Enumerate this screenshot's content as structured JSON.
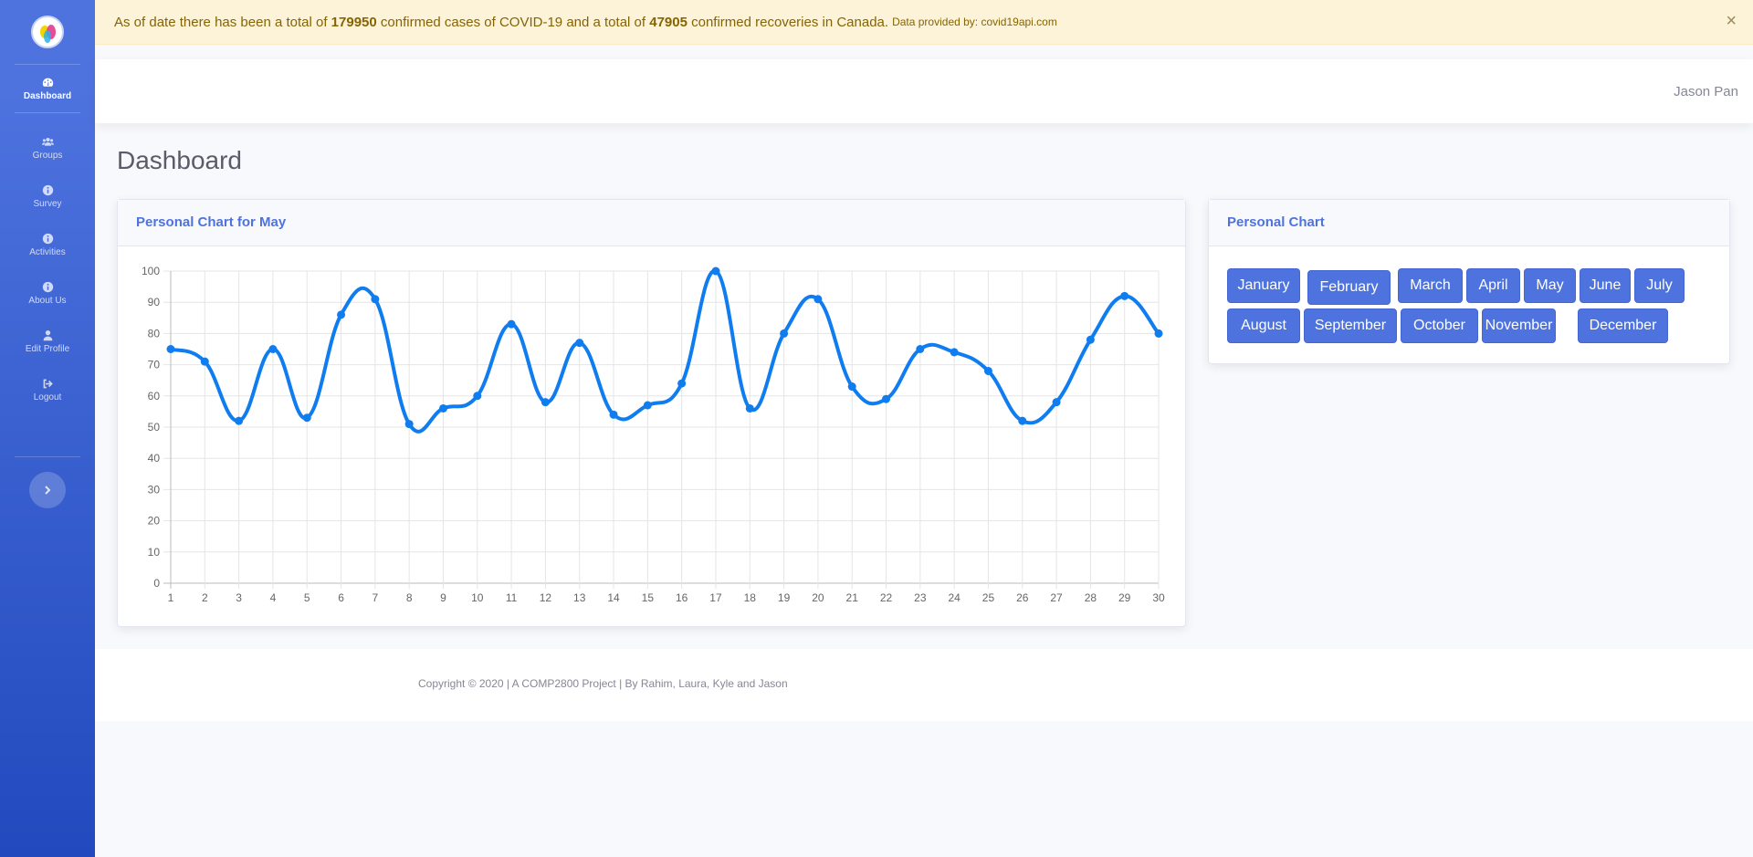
{
  "sidebar": {
    "items": [
      {
        "label": "Dashboard",
        "icon": "tachometer-icon"
      },
      {
        "label": "Groups",
        "icon": "users-icon"
      },
      {
        "label": "Survey",
        "icon": "info-circle-icon"
      },
      {
        "label": "Activities",
        "icon": "info-circle-icon"
      },
      {
        "label": "About Us",
        "icon": "info-circle-icon"
      },
      {
        "label": "Edit Profile",
        "icon": "user-icon"
      },
      {
        "label": "Logout",
        "icon": "sign-out-icon"
      }
    ]
  },
  "alert": {
    "text_1": "As of date there has been a total of",
    "confirmed": "179950",
    "text_2": "confirmed cases of COVID-19 and a total of",
    "recoveries": "47905",
    "text_3": "confirmed recoveries in Canada.",
    "source": "Data provided by: covid19api.com",
    "close": "×"
  },
  "topbar": {
    "user_name": "Jason Pan"
  },
  "page": {
    "title": "Dashboard"
  },
  "main_card": {
    "title": "Personal Chart for May"
  },
  "side_card": {
    "title": "Personal Chart",
    "months": [
      "January",
      "February",
      "March",
      "April",
      "May",
      "June",
      "July",
      "August",
      "September",
      "October",
      "November",
      "December"
    ]
  },
  "footer": {
    "text": "Copyright © 2020 | A COMP2800 Project | By Rahim, Laura, Kyle and Jason"
  },
  "colors": {
    "primary": "#4e73df",
    "line": "#0f7df0",
    "alert_bg": "#fdf3d8",
    "alert_text": "#856404"
  },
  "chart_data": {
    "type": "line",
    "x": [
      1,
      2,
      3,
      4,
      5,
      6,
      7,
      8,
      9,
      10,
      11,
      12,
      13,
      14,
      15,
      16,
      17,
      18,
      19,
      20,
      21,
      22,
      23,
      24,
      25,
      26,
      27,
      28,
      29,
      30
    ],
    "series": [
      {
        "values": [
          75,
          71,
          52,
          75,
          53,
          86,
          91,
          51,
          56,
          60,
          83,
          58,
          77,
          54,
          57,
          64,
          100,
          56,
          80,
          91,
          63,
          59,
          75,
          74,
          68,
          52,
          58,
          78,
          92,
          80
        ]
      }
    ],
    "yticks": [
      0,
      10,
      20,
      30,
      40,
      50,
      60,
      70,
      80,
      90,
      100
    ],
    "ylim": [
      0,
      100
    ],
    "grid": true,
    "legend": "none",
    "title": "",
    "xlabel": "",
    "ylabel": ""
  }
}
